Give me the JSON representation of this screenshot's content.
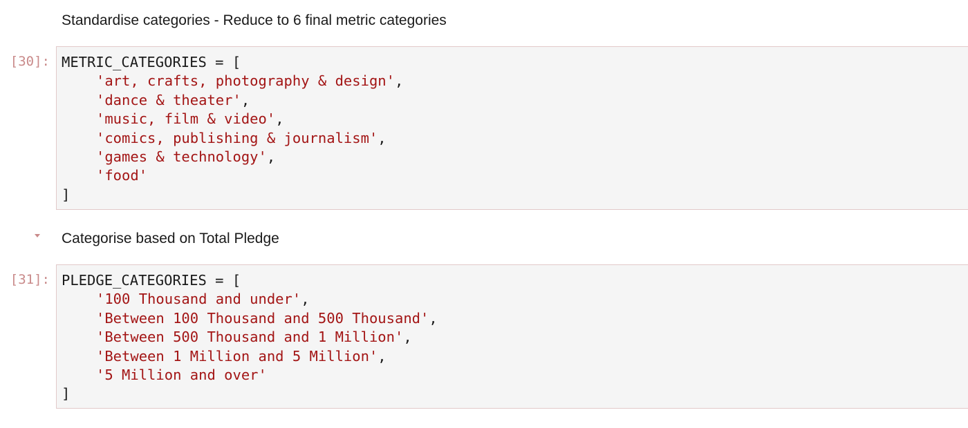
{
  "notebook": {
    "cells": [
      {
        "type": "markdown",
        "text": "Standardise categories - Reduce to 6 final metric categories"
      },
      {
        "type": "code",
        "prompt": "[30]:",
        "open_line": "METRIC_CATEGORIES = [",
        "items": [
          "'art, crafts, photography & design'",
          "'dance & theater'",
          "'music, film & video'",
          "'comics, publishing & journalism'",
          "'games & technology'",
          "'food'"
        ],
        "close_line": "]"
      },
      {
        "type": "markdown",
        "text": "Categorise based on Total Pledge",
        "collapser_icon": "caret-down-icon"
      },
      {
        "type": "code",
        "prompt": "[31]:",
        "open_line": "PLEDGE_CATEGORIES = [",
        "items": [
          "'100 Thousand and under'",
          "'Between 100 Thousand and 500 Thousand'",
          "'Between 500 Thousand and 1 Million'",
          "'Between 1 Million and 5 Million'",
          "'5 Million and over'"
        ],
        "close_line": "]"
      }
    ]
  },
  "colors": {
    "string": "#a31515",
    "prompt": "#c98a8a",
    "cell_background": "#f5f5f5",
    "cell_border": "#e2c9c9"
  }
}
